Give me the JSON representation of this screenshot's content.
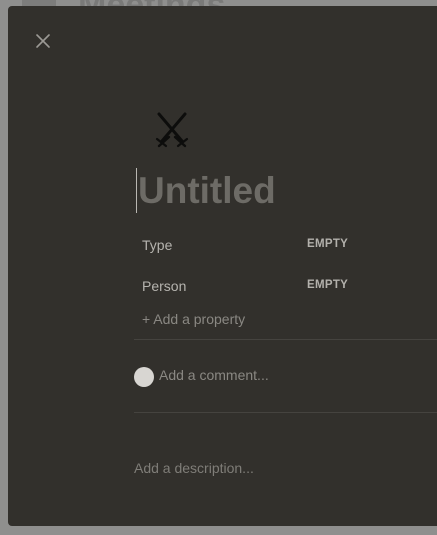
{
  "background_page": {
    "title": "Meetings"
  },
  "modal": {
    "close_icon": "close-icon",
    "page_icon": "crossed-swords-icon",
    "title_placeholder": "Untitled",
    "properties": [
      {
        "name": "Type",
        "value": "EMPTY"
      },
      {
        "name": "Person",
        "value": "EMPTY"
      }
    ],
    "add_property_label": "+ Add a property",
    "comment_placeholder": "Add a comment...",
    "description_placeholder": "Add a description..."
  },
  "colors": {
    "modal_background": "#32302c",
    "backdrop": "#8f8f8e"
  }
}
